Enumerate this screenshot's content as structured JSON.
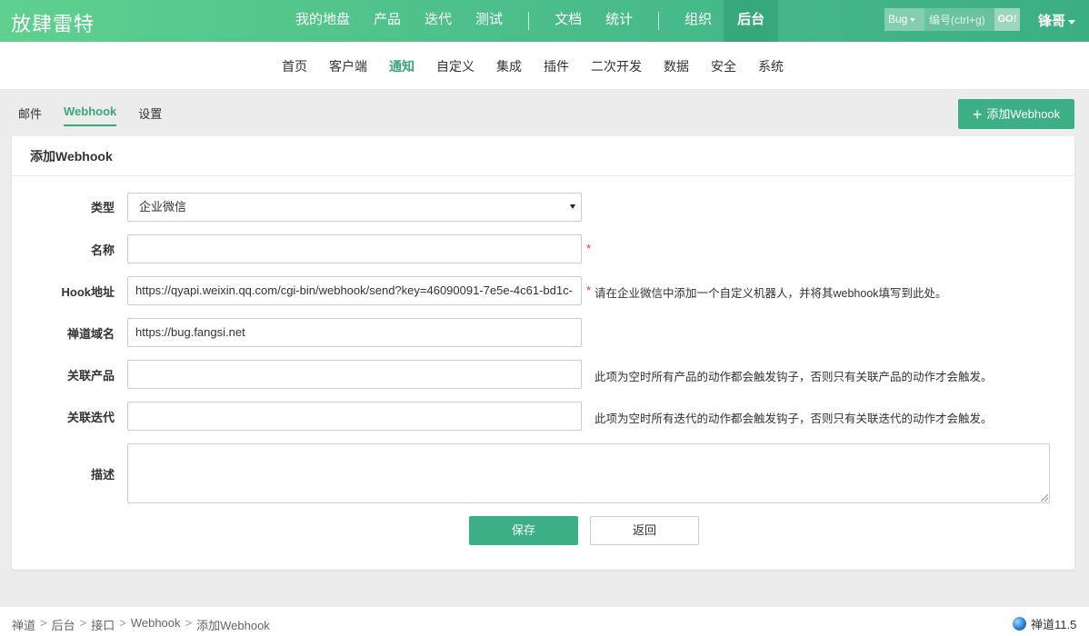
{
  "header": {
    "brand": "放肆雷特",
    "nav": [
      {
        "label": "我的地盘"
      },
      {
        "label": "产品"
      },
      {
        "label": "迭代"
      },
      {
        "label": "测试"
      },
      {
        "label": "文档"
      },
      {
        "label": "统计"
      },
      {
        "label": "组织"
      },
      {
        "label": "后台",
        "active": true
      }
    ],
    "search": {
      "type": "Bug",
      "placeholder": "编号(ctrl+g)",
      "go_label": "GO!"
    },
    "user": "锋哥"
  },
  "subnav": {
    "items": [
      "首页",
      "客户端",
      "通知",
      "自定义",
      "集成",
      "插件",
      "二次开发",
      "数据",
      "安全",
      "系统"
    ],
    "active": "通知"
  },
  "tabs": {
    "items": [
      "邮件",
      "Webhook",
      "设置"
    ],
    "active": "Webhook"
  },
  "add_button": {
    "icon": "plus-icon",
    "label": "添加Webhook"
  },
  "form": {
    "title": "添加Webhook",
    "type": {
      "label": "类型",
      "value": "企业微信"
    },
    "name": {
      "label": "名称",
      "value": "",
      "required": "*"
    },
    "url": {
      "label": "Hook地址",
      "value": "https://qyapi.weixin.qq.com/cgi-bin/webhook/send?key=46090091-7e5e-4c61-bd1c-",
      "required": "*",
      "hint": "请在企业微信中添加一个自定义机器人，并将其webhook填写到此处。"
    },
    "domain": {
      "label": "禅道域名",
      "value": "https://bug.fangsi.net"
    },
    "products": {
      "label": "关联产品",
      "value": "",
      "hint": "此项为空时所有产品的动作都会触发钩子，否则只有关联产品的动作才会触发。"
    },
    "executions": {
      "label": "关联迭代",
      "value": "",
      "hint": "此项为空时所有迭代的动作都会触发钩子，否则只有关联迭代的动作才会触发。"
    },
    "desc": {
      "label": "描述",
      "value": ""
    },
    "save_label": "保存",
    "back_label": "返回"
  },
  "footer": {
    "breadcrumb": [
      "禅道",
      "后台",
      "接口",
      "Webhook",
      "添加Webhook"
    ],
    "separator": ">",
    "version": "禅道11.5"
  },
  "colors": {
    "accent": "#3caf86",
    "header_start": "#5fd08f",
    "header_end": "#3cae84",
    "required": "#e33333"
  }
}
